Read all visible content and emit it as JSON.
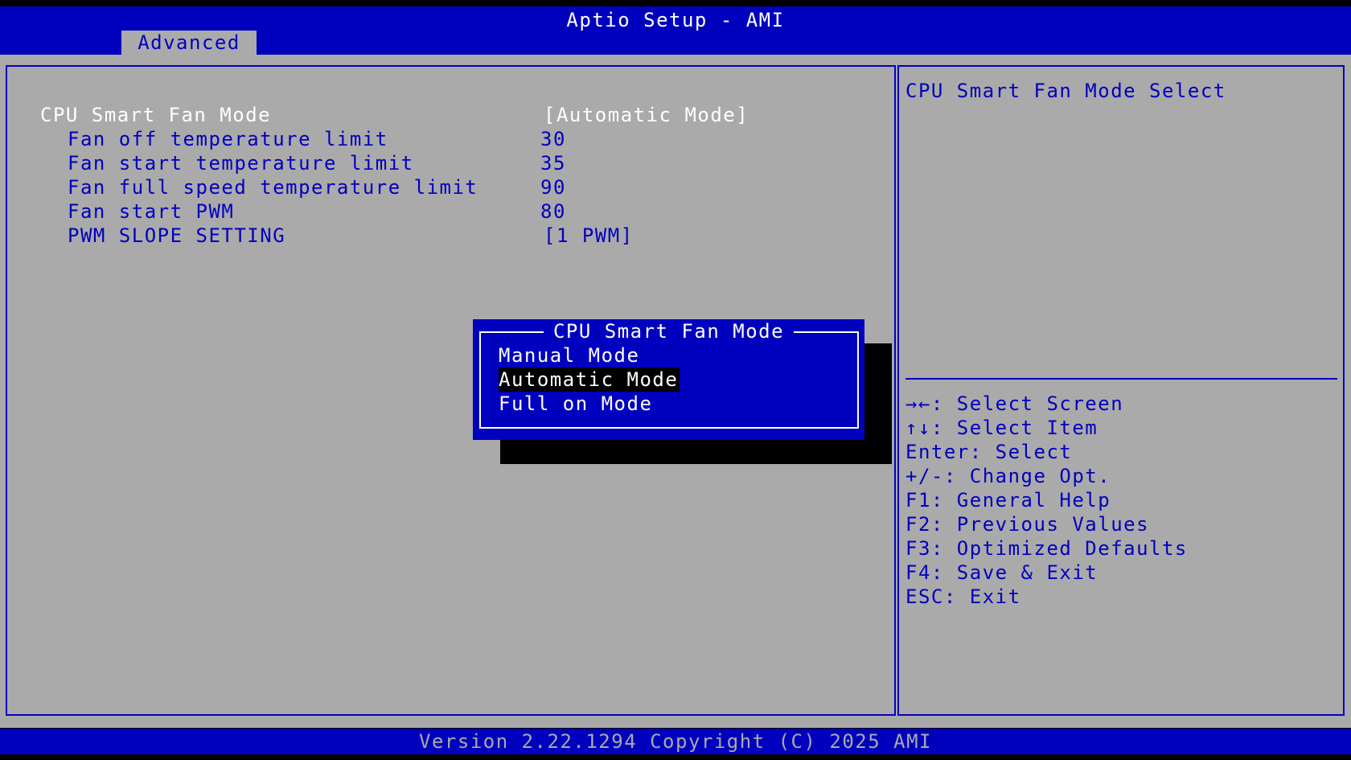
{
  "header": {
    "title": "Aptio Setup - AMI",
    "tabs": [
      {
        "label": "Advanced"
      }
    ]
  },
  "settings": [
    {
      "label": "CPU Smart Fan Mode",
      "value": "[Automatic Mode]"
    },
    {
      "label": "Fan off temperature limit",
      "value": "30"
    },
    {
      "label": "Fan start temperature limit",
      "value": "35"
    },
    {
      "label": "Fan full speed temperature limit",
      "value": "90"
    },
    {
      "label": "Fan start PWM",
      "value": "80"
    },
    {
      "label": "PWM SLOPE SETTING",
      "value": "[1 PWM]"
    }
  ],
  "help": {
    "description": "CPU Smart Fan Mode Select",
    "keys": [
      "→←: Select Screen",
      "↑↓: Select Item",
      "Enter: Select",
      "+/-: Change Opt.",
      "F1: General Help",
      "F2: Previous Values",
      "F3: Optimized Defaults",
      "F4: Save & Exit",
      "ESC: Exit"
    ]
  },
  "popup": {
    "title": "CPU Smart Fan Mode",
    "options": [
      "Manual Mode",
      "Automatic Mode",
      "Full on Mode"
    ],
    "selected": "Automatic Mode"
  },
  "footer": {
    "text": "Version 2.22.1294 Copyright (C) 2025 AMI"
  },
  "colors": {
    "bios_blue": "#0000bf",
    "bios_gray": "#aaaaaa",
    "text_white": "#ffffff",
    "shadow_black": "#000000"
  }
}
